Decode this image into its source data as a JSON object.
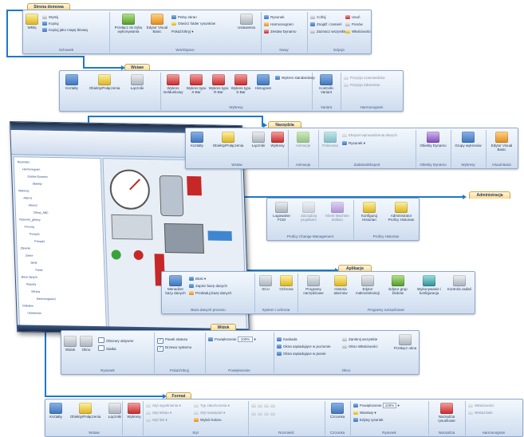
{
  "colors": {
    "connector": "#1d79c9",
    "tab_active": "#ffd98a",
    "ribbon_bg": "#dde8f5"
  },
  "tab_home": "Strona domowa",
  "home": {
    "paste": "Wklej",
    "cut": "Wytnij",
    "copy": "Kopiuj",
    "copy_as_image": "Kopiuj jako mapę bitową",
    "clipboard_group": "Schowek",
    "runtime": "Przełącz do trybu wykonywania",
    "vb": "Edytor Visual Basic",
    "full_screen": "Pełny ekran",
    "open_folder": "Otwórz folder rysunków",
    "show_hide": "Pokaż/Ukryj",
    "settings": "Ustawienia",
    "workspace_group": "WorkSpace",
    "drawing": "Rysunek",
    "schedule": "Harmonogram",
    "dynamo_set": "Zestaw Dynamo",
    "new_group": "Nowy",
    "undo": "Cofnij",
    "find_replace": "Znajdź i zamień",
    "select_all": "Zaznacz wszystkie",
    "delete": "Usuń",
    "redo": "Ponów",
    "properties": "Właściwości",
    "edit_group": "Edycja"
  },
  "tab_insert": "Wstaw",
  "insert": {
    "shapes": "Kształty",
    "objects": "Obiekty/Połączenia",
    "connectors": "Łączniki",
    "chart_line": "Wykres meldunkowy",
    "chart_xbar": "Wykres typu X-Bar",
    "chart_rbar": "Wykres typu R-Bar",
    "chart_sbar": "Wykres typu S-Bar",
    "histogram": "Histogram",
    "standard_chart": "Wykres standardowy",
    "charts_group": "Wykresy",
    "control": "Kontrolki Variant",
    "variant_group": "Variant",
    "alarm_pos": "Pozycja czasowników",
    "alarm_hist": "Pozycja Zdarzenia",
    "schedule_group": "Harmonogram"
  },
  "tab_tools": "Narzędzia",
  "tools": {
    "shapes": "Kształty",
    "objects": "Obiekty/Połączenia",
    "connectors": "Łączniki",
    "charts": "Wykresy",
    "insert_group": "Wstaw",
    "animation": "Animacje",
    "animation_group": "Animacje",
    "reports": "Polecenia",
    "export": "Eksport wprowadzenia danych",
    "drawing": "Rysunek",
    "tasks_group": "Zadania/Eksport",
    "dynamo": "Obiekty Dynamo",
    "dynamo_group": "Obiekty Dynamo",
    "groups": "Grupy wykresów",
    "groups_group": "Wykresy",
    "vb": "Edytor Visual Basic",
    "vb_group": "Visual Basic"
  },
  "tab_admin": "Administracja",
  "admin": {
    "login": "Logowanie FCM",
    "password": "Zarządzaj projektem",
    "client": "Klient Machine Edition",
    "pcm_group": "Proficy Change Management",
    "configure": "Konfiguruj Historian",
    "admin_historian": "Administrator Proficy Historian",
    "hist_group": "Proficy Historian"
  },
  "tab_apps": "Aplikacje",
  "apps": {
    "db_manager": "Menedżer bazy danych",
    "blocks": "Bloki",
    "save_db": "Zapisz bazę danych",
    "reload_db": "Przeładuj bazę danych",
    "db_group": "Baza danych procesu",
    "scu": "SCU",
    "security": "Ochrona",
    "system_group": "System i ochrona",
    "programs": "Programy narzędziowe",
    "alarm_history": "Historia alarmów",
    "macro_editor": "Edytor makroinstrukcji",
    "group_editor": "Edytor grup bloków",
    "run_config": "Wykonywanie i konfiguracja",
    "task_control": "Kontrola zadań",
    "tools_group": "Programy narzędziowe"
  },
  "tab_view": "Widok",
  "view": {
    "view": "Widok",
    "window": "Okno",
    "drawing_group": "Rysunek",
    "active_areas": "Obszary aktywne",
    "grid": "Siatka",
    "status_bar": "Pasek statusu",
    "system_tree": "Drzewo systemu",
    "show_group": "Pokaż/Ukryj",
    "zoom": "Powiększenie",
    "zoom_value": "100%",
    "zoom_group": "Powiększenie",
    "cascade": "Kaskada",
    "tile_h": "Okna sąsiadujące w poziomie",
    "tile_v": "Okna sąsiadujące w pionie",
    "close_all": "Zamknij wszystkie",
    "win_props": "Okno Właściwości",
    "switch": "Przełącz okna",
    "window_group": "Okno"
  },
  "tab_format": "Format",
  "format": {
    "shapes": "Kształty",
    "objects": "Obiekty/Połączenia",
    "connectors": "Łączniki",
    "charts": "Wykresy",
    "insert_group": "Wstaw",
    "line_style": "Styl wypełnienia",
    "text_style": "Styl tekstu",
    "fill_style": "Styl linii",
    "line_width": "Typ zakończenia",
    "line_pattern": "Styl nawiązań",
    "select_color": "Wybór koloru",
    "style_group": "Styl",
    "arrange_group": "Rozmieść",
    "font": "Czcionka",
    "font_group": "Czcionka",
    "zoom": "Powiększenie",
    "zoom_value": "100%",
    "layers": "Warstwy",
    "edit_drawing": "Edytuj rysunek",
    "drawing_group": "Rysunek",
    "tools": "Narzędzia rysunkowe",
    "tools_group": "Narzędzia",
    "props": "Właściwości",
    "tips": "Wskazówki",
    "hint_group": "Harmonogram"
  },
  "window": {
    "tree_items": [
      "Rysunek1",
      "Harmonogram",
      "Zestaw Dynamo",
      "Obiekty",
      "Wykresy",
      "Alarm1",
      "Alarm2",
      "Obraz_ABC",
      "Rysunek_glowny",
      "Procesy",
      "Pompa1",
      "Pompa2",
      "Zbiornik",
      "Zawor",
      "Silnik",
      "Panel",
      "Baza danych",
      "Raporty",
      "Ekrany",
      "Harmonogram2",
      "Globalne",
      "Ustawienia"
    ]
  }
}
